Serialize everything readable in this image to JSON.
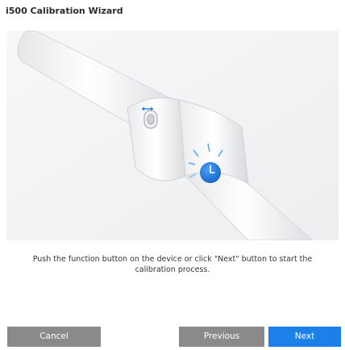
{
  "window": {
    "title": "i500 Calibration Wizard"
  },
  "illustration": {
    "description_icon": "device-button-press-icon"
  },
  "instruction": {
    "text": "Push the function button on the device or click \"Next\" button to start the calibration process."
  },
  "buttons": {
    "cancel_label": "Cancel",
    "previous_label": "Previous",
    "next_label": "Next"
  },
  "colors": {
    "primary": "#1d7fe8",
    "secondary_button": "#8a8a8a",
    "title_text": "#2b2b2b",
    "body_text": "#333333"
  }
}
